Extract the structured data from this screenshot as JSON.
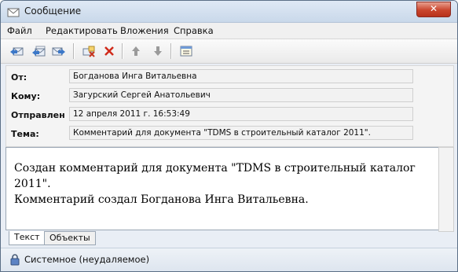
{
  "window": {
    "title": "Сообщение",
    "close_label": "✕"
  },
  "menu": {
    "items": [
      "Файл",
      "Редактировать",
      "Вложения",
      "Справка"
    ]
  },
  "toolbar": {
    "icons": [
      "reply-icon",
      "reply-all-icon",
      "forward-icon",
      "delete-icon",
      "cancel-icon",
      "arrow-up-icon",
      "arrow-down-icon",
      "details-icon"
    ]
  },
  "headers": {
    "from_label": "От:",
    "from_value": "Богданова Инга Витальевна",
    "to_label": "Кому:",
    "to_value": "Загурский Сергей Анатольевич",
    "sent_label": "Отправлен",
    "sent_value": "12 апреля 2011 г. 16:53:49",
    "subject_label": "Тема:",
    "subject_value": "Комментарий для документа \"TDMS в строительный каталог 2011\"."
  },
  "body": {
    "line1": "Создан комментарий для документа \"TDMS в строительный каталог 2011\".",
    "line2": "Комментарий создал Богданова Инга Витальевна."
  },
  "tabs": {
    "text_label": "Текст",
    "objects_label": "Объекты"
  },
  "status": {
    "text": "Системное (неудаляемое)"
  }
}
